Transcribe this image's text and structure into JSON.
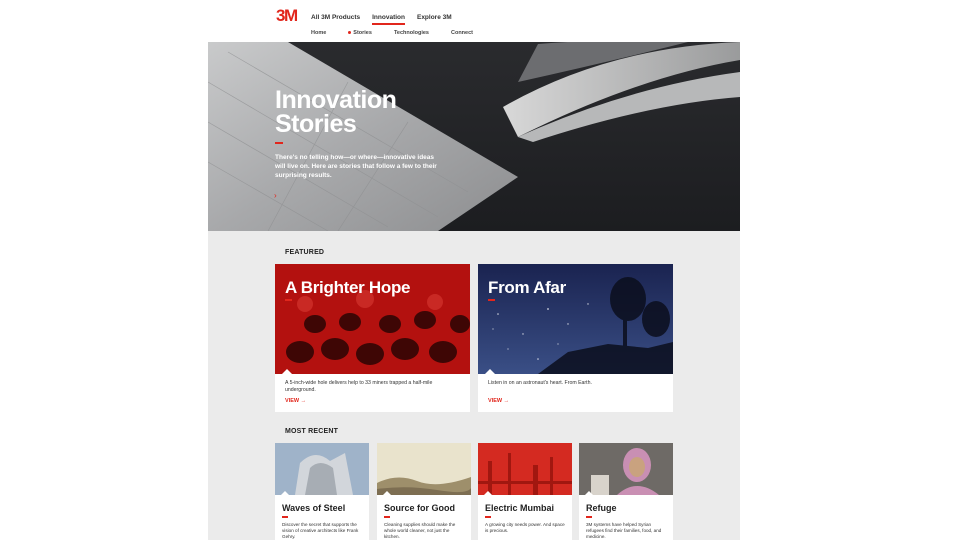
{
  "header": {
    "logo": "3M",
    "primary_nav": [
      "All 3M Products",
      "Innovation",
      "Explore 3M"
    ],
    "sub_nav": [
      "Home",
      "Stories",
      "Technologies",
      "Connect"
    ]
  },
  "hero": {
    "title_line1": "Innovation",
    "title_line2": "Stories",
    "description": "There's no telling how—or where—innovative ideas will live on. Here are stories that follow a few to their surprising results.",
    "arrow": "›"
  },
  "featured": {
    "label": "FEATURED",
    "cards": [
      {
        "title": "A Brighter Hope",
        "description": "A 5-inch-wide hole delivers help to 33 miners trapped a half-mile underground.",
        "cta": "VIEW →"
      },
      {
        "title": "From Afar",
        "description": "Listen in on an astronaut's heart. From Earth.",
        "cta": "VIEW →"
      }
    ]
  },
  "most_recent": {
    "label": "MOST RECENT",
    "cards": [
      {
        "title": "Waves of Steel",
        "description": "Discover the secret that supports the vision of creative architects like Frank Gehry."
      },
      {
        "title": "Source for Good",
        "description": "Cleaning supplies should make the whole world cleaner, not just the kitchen."
      },
      {
        "title": "Electric Mumbai",
        "description": "A growing city needs power. And space is precious."
      },
      {
        "title": "Refuge",
        "description": "3M systems have helped Syrian refugees find their families, food, and medicine."
      }
    ]
  },
  "colors": {
    "accent": "#e1261c",
    "background": "#ebebeb"
  }
}
